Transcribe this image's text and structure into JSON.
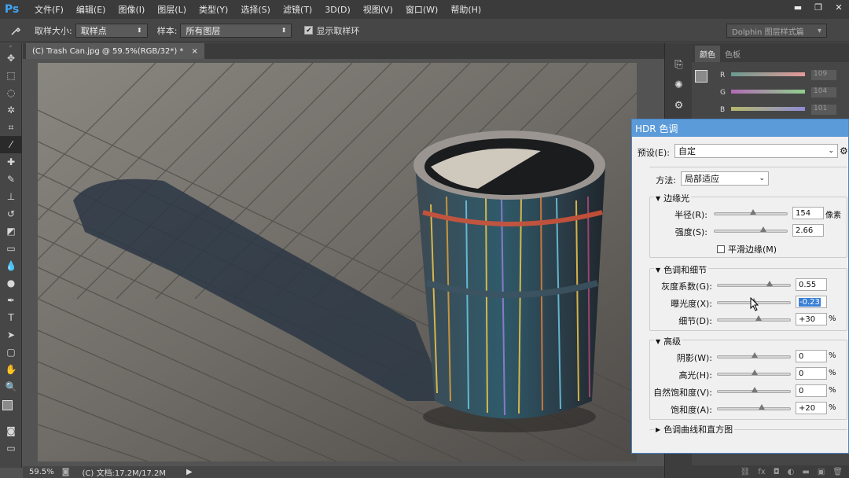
{
  "app": {
    "logo": "Ps",
    "menu": [
      "文件(F)",
      "编辑(E)",
      "图像(I)",
      "图层(L)",
      "类型(Y)",
      "选择(S)",
      "滤镜(T)",
      "3D(D)",
      "视图(V)",
      "窗口(W)",
      "帮助(H)"
    ]
  },
  "options": {
    "sample_size_label": "取样大小:",
    "sample_size_value": "取样点",
    "sample_label": "样本:",
    "sample_value": "所有图层",
    "show_ring_label": "显示取样环",
    "workspace": "Dolphin 图层样式篇"
  },
  "document": {
    "tab": "(C) Trash Can.jpg @ 59.5%(RGB/32*) *",
    "close": "×"
  },
  "status": {
    "zoom": "59.5%",
    "doc": "(C) 文档:17.2M/17.2M",
    "arrow": "▶"
  },
  "color_panel": {
    "tabs": [
      "颜色",
      "色板"
    ],
    "channels": [
      {
        "name": "R",
        "value": "109"
      },
      {
        "name": "G",
        "value": "104"
      },
      {
        "name": "B",
        "value": "101"
      }
    ]
  },
  "hdr": {
    "title": "HDR 色调",
    "preset_label": "预设(E):",
    "preset_value": "自定",
    "method_label": "方法:",
    "method_value": "局部适应",
    "edge_title": "边缘光",
    "radius_label": "半径(R):",
    "radius_value": "154",
    "radius_unit": "像素",
    "strength_label": "强度(S):",
    "strength_value": "2.66",
    "smooth_label": "平滑边缘(M)",
    "tone_title": "色调和细节",
    "gamma_label": "灰度系数(G):",
    "gamma_value": "0.55",
    "exposure_label": "曝光度(X):",
    "exposure_value": "-0.23",
    "detail_label": "细节(D):",
    "detail_value": "+30",
    "detail_unit": "%",
    "adv_title": "高级",
    "shadow_label": "阴影(W):",
    "shadow_value": "0",
    "shadow_unit": "%",
    "highlight_label": "高光(H):",
    "highlight_value": "0",
    "highlight_unit": "%",
    "vibrance_label": "自然饱和度(V):",
    "vibrance_value": "0",
    "vibrance_unit": "%",
    "saturation_label": "饱和度(A):",
    "saturation_value": "+20",
    "saturation_unit": "%",
    "curve_title": "色调曲线和直方图"
  }
}
